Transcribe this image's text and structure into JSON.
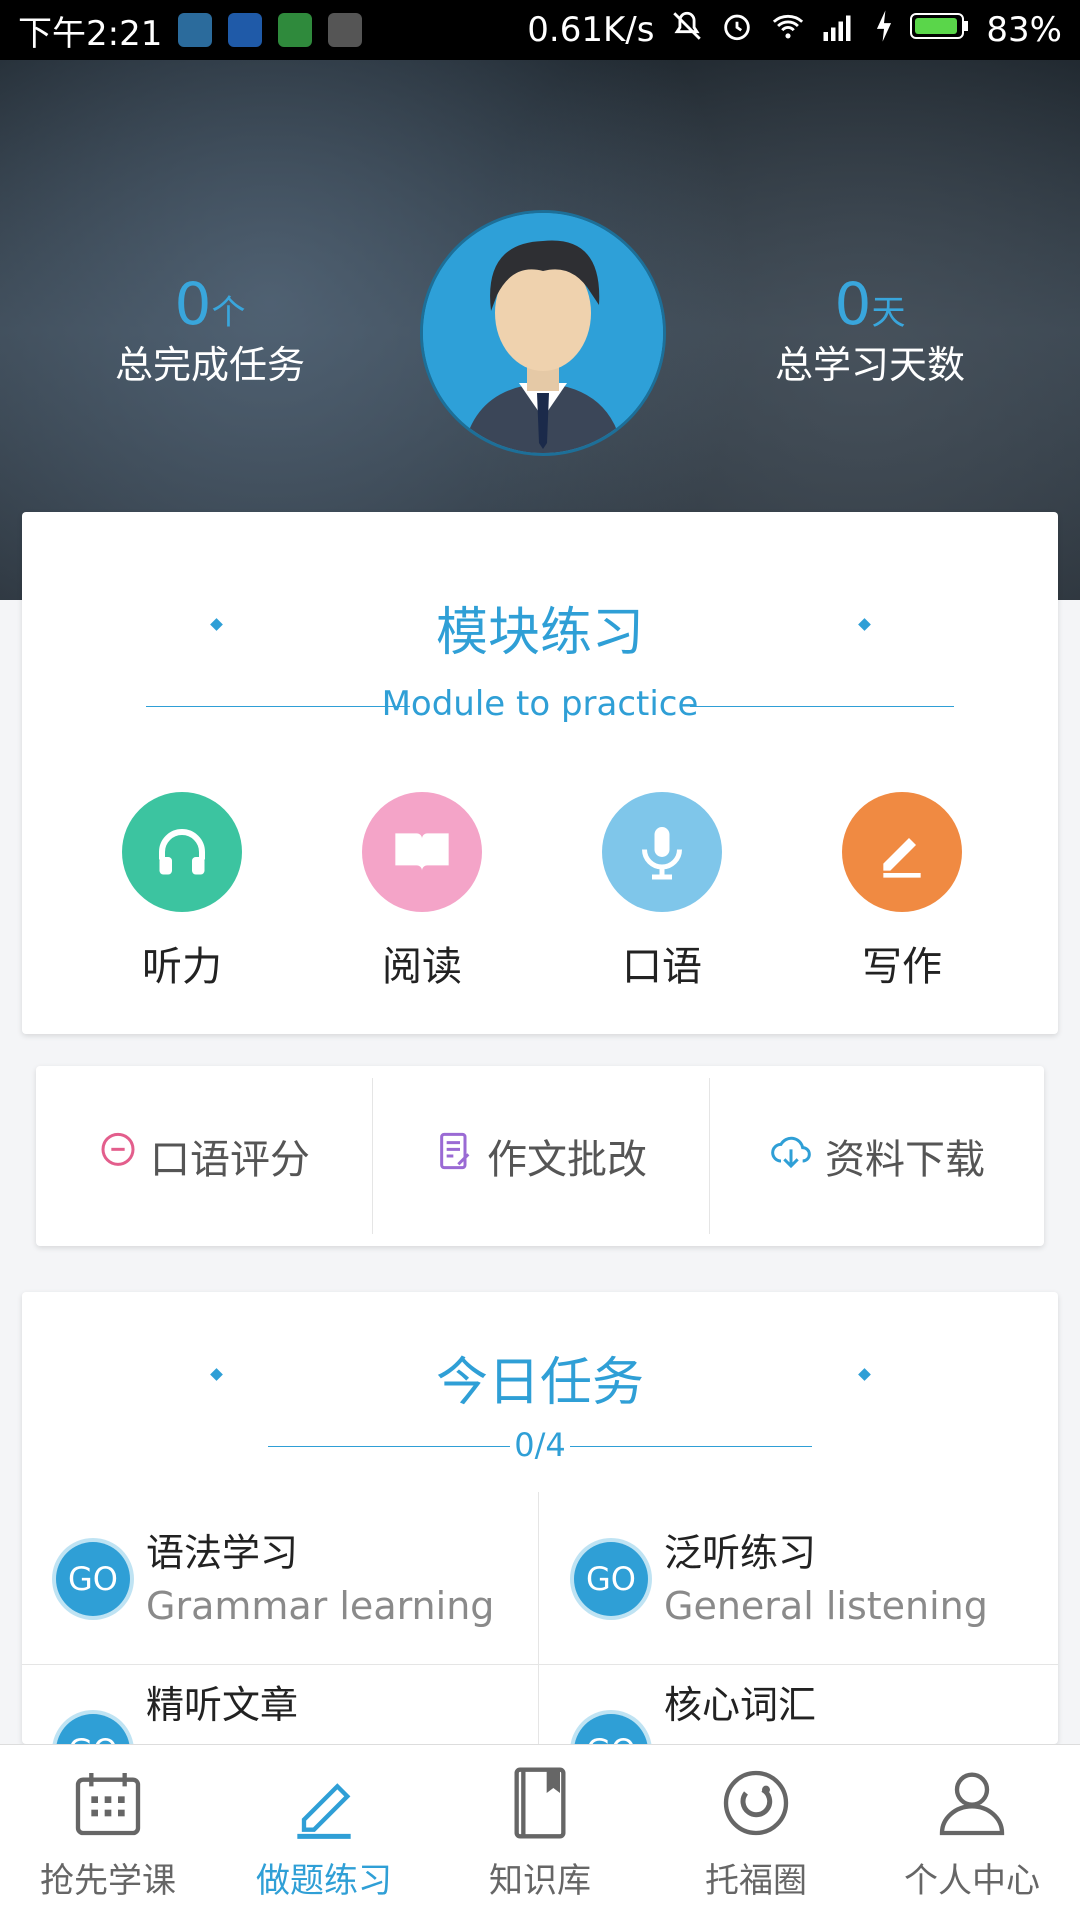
{
  "status_bar": {
    "time": "下午2:21",
    "net_speed": "0.61K/s",
    "battery": "83%"
  },
  "hero": {
    "tasks_value": "0",
    "tasks_unit": "个",
    "tasks_label": "总完成任务",
    "days_value": "0",
    "days_unit": "天",
    "days_label": "总学习天数"
  },
  "module_section": {
    "title": "模块练习",
    "subtitle": "Module to practice",
    "modules": [
      {
        "label": "听力",
        "icon": "headphones-icon",
        "color": "#3cc4a0"
      },
      {
        "label": "阅读",
        "icon": "book-icon",
        "color": "#f4a4c8"
      },
      {
        "label": "口语",
        "icon": "microphone-icon",
        "color": "#7fc6ea"
      },
      {
        "label": "写作",
        "icon": "pencil-icon",
        "color": "#f08a42"
      }
    ]
  },
  "tools": [
    {
      "label": "口语评分",
      "icon": "chat-bubble-icon",
      "color": "#e35e8c"
    },
    {
      "label": "作文批改",
      "icon": "document-edit-icon",
      "color": "#9a6ad4"
    },
    {
      "label": "资料下载",
      "icon": "cloud-download-icon",
      "color": "#2f9fd6"
    }
  ],
  "today_section": {
    "title": "今日任务",
    "progress": "0/4",
    "tasks": [
      {
        "go": "GO",
        "title": "语法学习",
        "subtitle": "Grammar learning"
      },
      {
        "go": "GO",
        "title": "泛听练习",
        "subtitle": "General listening"
      },
      {
        "go": "GO",
        "title": "精听文章",
        "subtitle": ""
      },
      {
        "go": "GO",
        "title": "核心词汇",
        "subtitle": ""
      }
    ]
  },
  "bottom_nav": [
    {
      "label": "抢先学课",
      "icon": "calendar-icon",
      "active": false
    },
    {
      "label": "做题练习",
      "icon": "pencil-icon",
      "active": true
    },
    {
      "label": "知识库",
      "icon": "bookmark-book-icon",
      "active": false
    },
    {
      "label": "托福圈",
      "icon": "circle-refresh-icon",
      "active": false
    },
    {
      "label": "个人中心",
      "icon": "person-icon",
      "active": false
    }
  ]
}
